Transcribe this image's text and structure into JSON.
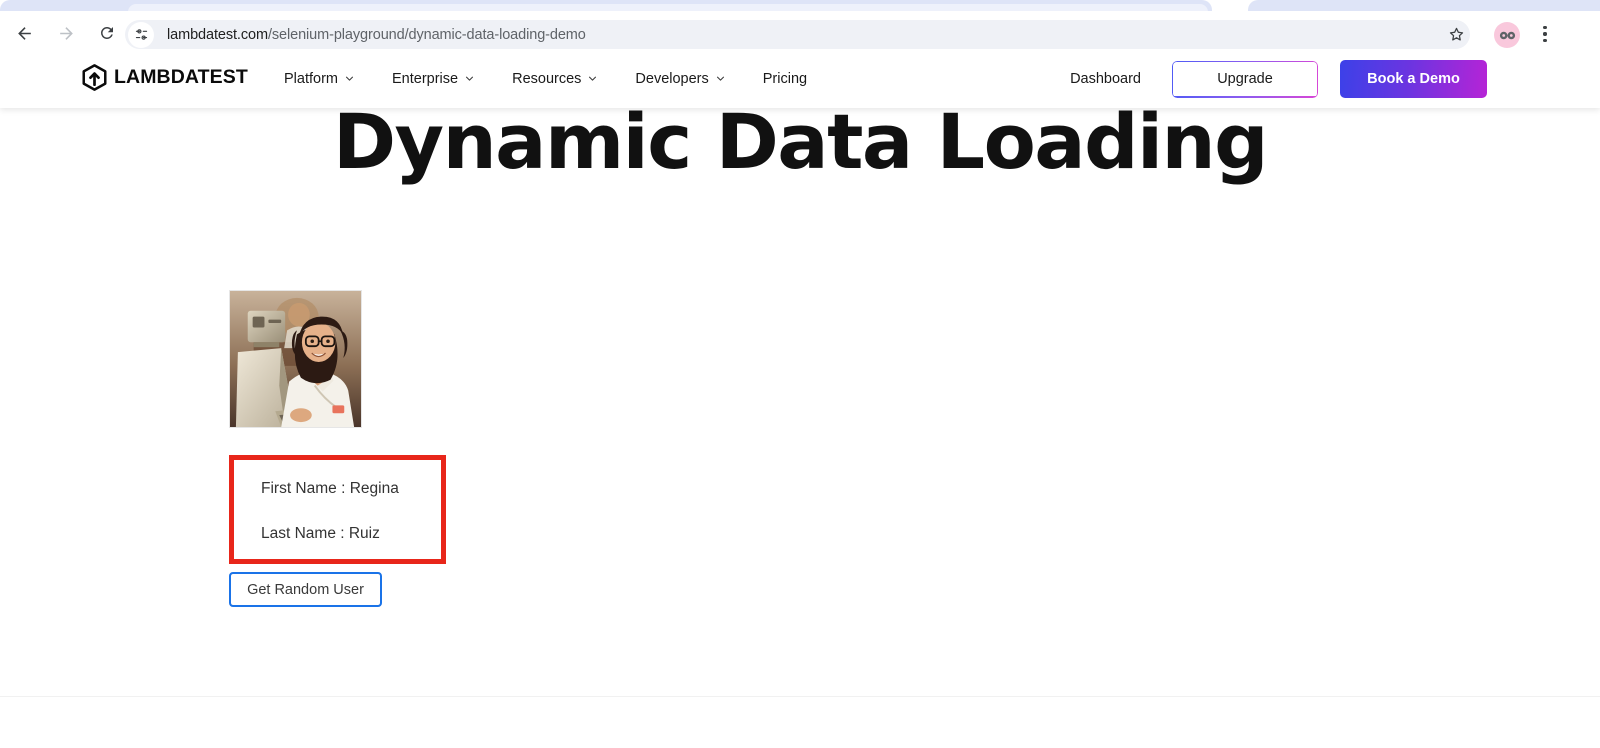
{
  "browser": {
    "back_icon": "back-arrow-icon",
    "forward_icon": "forward-arrow-icon",
    "reload_icon": "reload-icon",
    "site_info_icon": "site-settings-tune-icon",
    "url_host": "lambdatest.com",
    "url_path": "/selenium-playground/dynamic-data-loading-demo",
    "url_full": "lambdatest.com/selenium-playground/dynamic-data-loading-demo",
    "bookmark_icon": "bookmark-star-icon",
    "profile_icon": "profile-avatar-icon",
    "menu_icon": "three-dot-menu-icon"
  },
  "site_header": {
    "logo_icon": "lambdatest-hexagon-arrow-logo",
    "brand": "LAMBDATEST",
    "nav": [
      {
        "label": "Platform",
        "has_dropdown": true
      },
      {
        "label": "Enterprise",
        "has_dropdown": true
      },
      {
        "label": "Resources",
        "has_dropdown": true
      },
      {
        "label": "Developers",
        "has_dropdown": true
      },
      {
        "label": "Pricing",
        "has_dropdown": false
      }
    ],
    "dashboard_label": "Dashboard",
    "upgrade_label": "Upgrade",
    "book_demo_label": "Book a Demo",
    "gradient_start": "#3c41e8",
    "gradient_end": "#b624d6"
  },
  "main": {
    "title": "Dynamic Data Loading",
    "photo_alt": "woman-at-vintage-computer-photo",
    "first_name_line": "First Name : Regina",
    "last_name_line": "Last Name : Ruiz",
    "get_random_user_label": "Get Random User",
    "highlight_color": "#e8261a",
    "focus_color": "#1a73e8"
  }
}
